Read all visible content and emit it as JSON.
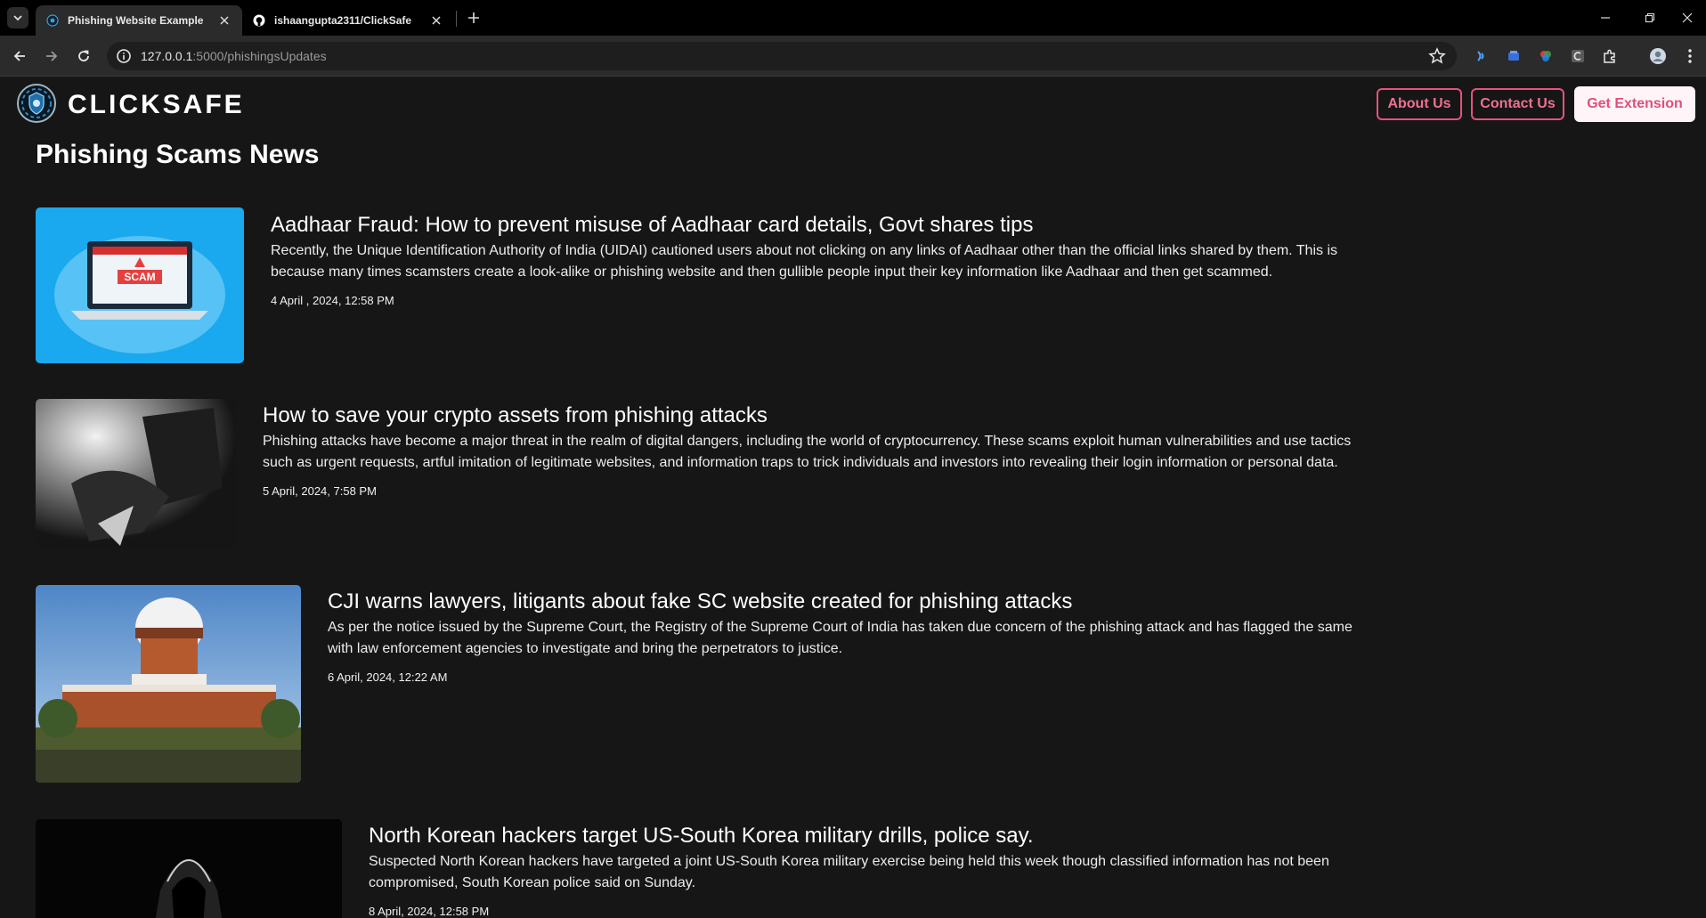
{
  "browser": {
    "tabs": [
      {
        "title": "Phishing Website Example",
        "active": true
      },
      {
        "title": "ishaangupta2311/ClickSafe",
        "active": false
      }
    ],
    "url_host": "127.0.0.1",
    "url_path": ":5000/phishingsUpdates"
  },
  "site": {
    "brand": "CLICKSAFE",
    "nav": {
      "about": "About Us",
      "contact": "Contact Us",
      "extension": "Get Extension"
    },
    "accent_color": "#e6527c"
  },
  "page": {
    "heading": "Phishing Scams News"
  },
  "articles": [
    {
      "title": "Aadhaar Fraud: How to prevent misuse of Aadhaar card details, Govt shares tips",
      "description": "Recently, the Unique Identification Authority of India (UIDAI) cautioned users about not clicking on any links of Aadhaar other than the official links shared by them. This is because many times scamsters create a look-alike or phishing website and then gullible people input their key information like Aadhaar and then get scammed.",
      "date": "4 April , 2024, 12:58 PM",
      "image_text": "SCAM"
    },
    {
      "title": "How to save your crypto assets from phishing attacks",
      "description": "Phishing attacks have become a major threat in the realm of digital dangers, including the world of cryptocurrency. These scams exploit human vulnerabilities and use tactics such as urgent requests, artful imitation of legitimate websites, and information traps to trick individuals and investors into revealing their login information or personal data.",
      "date": "5 April, 2024, 7:58 PM"
    },
    {
      "title": "CJI warns lawyers, litigants about fake SC website created for phishing attacks",
      "description": "As per the notice issued by the Supreme Court, the Registry of the Supreme Court of India has taken due concern of the phishing attack and has flagged the same with law enforcement agencies to investigate and bring the perpetrators to justice.",
      "date": "6 April, 2024, 12:22 AM"
    },
    {
      "title": "North Korean hackers target US-South Korea military drills, police say.",
      "description": "Suspected North Korean hackers have targeted a joint US-South Korea military exercise being held this week though classified information has not been compromised, South Korean police said on Sunday.",
      "date": "8 April, 2024, 12:58 PM"
    }
  ]
}
